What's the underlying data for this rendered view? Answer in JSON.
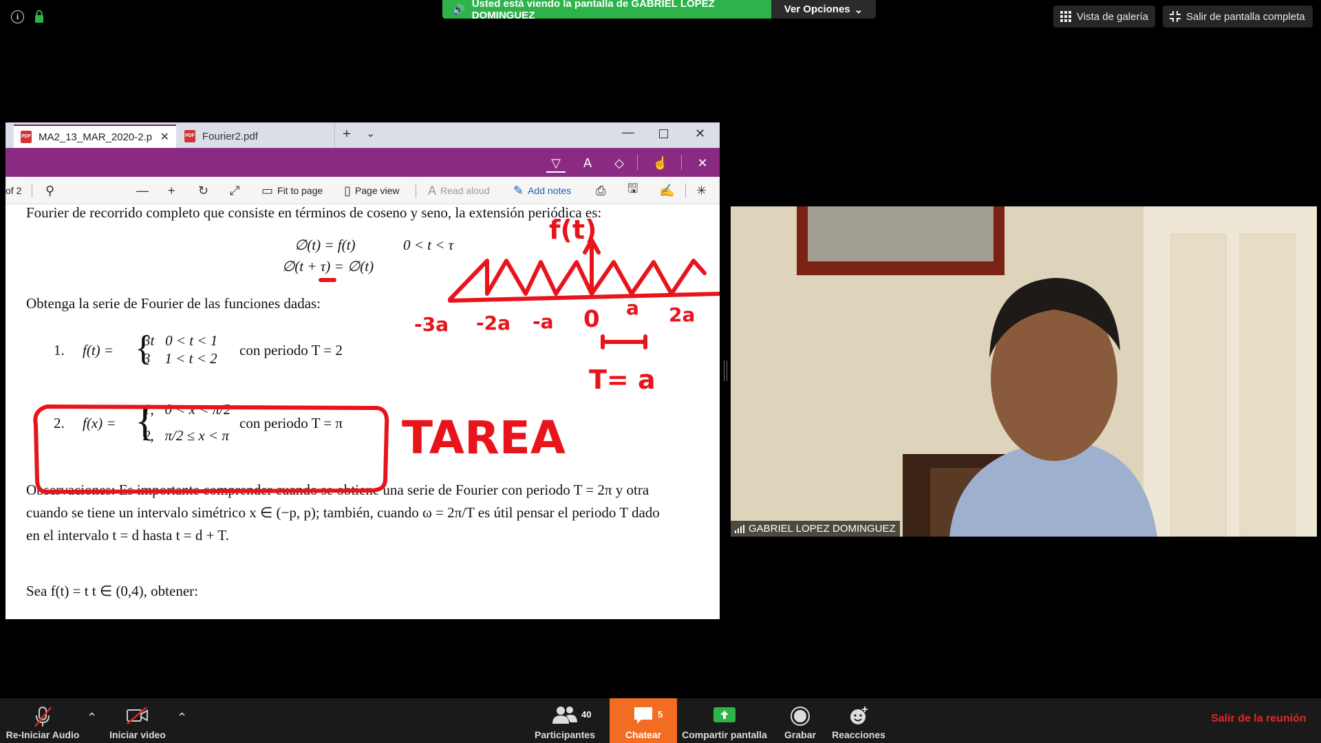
{
  "topbar": {
    "info_icon": "info-icon",
    "lock_icon": "lock-icon",
    "share_banner": "Usted está viendo la pantalla de GABRIEL LOPEZ DOMINGUEZ",
    "view_options": "Ver Opciones",
    "gallery_view": "Vista de galería",
    "exit_fullscreen": "Salir de pantalla completa"
  },
  "pdf_window": {
    "tabs": [
      {
        "label": "MA2_13_MAR_2020-2.p",
        "active": true
      },
      {
        "label": "Fourier2.pdf",
        "active": false
      }
    ],
    "window_controls": [
      "minimize-icon",
      "maximize-icon",
      "close-icon"
    ],
    "ink_tools": [
      "pen-icon",
      "highlighter-icon",
      "eraser-icon",
      "touch-writing-icon",
      "close-icon"
    ],
    "toolbar": {
      "page_indicator": "of 2",
      "fit_to_page": "Fit to page",
      "page_view": "Page view",
      "read_aloud": "Read aloud",
      "add_notes": "Add notes"
    },
    "document": {
      "line1": "Fourier de recorrido completo que consiste en términos de coseno y seno, la extensión periódica es:",
      "eq1": "∅(t) = f(t)",
      "eq1_cond": "0 < t < τ",
      "eq2": "∅(t + τ) = ∅(t)",
      "instruction": "Obtenga la serie de Fourier de las funciones dadas:",
      "item1_num": "1.",
      "item1_lhs": "f(t) =",
      "item1_case1": "3t   0 < t < 1",
      "item1_case2": "3    1 < t < 2",
      "item1_period": "con periodo T = 2",
      "item2_num": "2.",
      "item2_lhs": "f(x) =",
      "item2_case1": "1,   0 < x < π/2",
      "item2_case2": "2,   π/2 ≤ x < π",
      "item2_period": "con periodo T = π",
      "obs1": "Observaciones: Es importante comprender cuando se obtiene una serie de Fourier con periodo T = 2π y otra",
      "obs2": "cuando se tiene un intervalo simétrico x ∈ (−p, p); también, cuando ω = 2π/T es útil pensar el periodo T dado",
      "obs3": "en el intervalo t = d hasta t = d + T.",
      "exercise": "Sea f(t) = t   t ∈ (0,4), obtener:"
    },
    "annotations": {
      "ft": "f(t)",
      "axis_labels": [
        "-3a",
        "-2a",
        "-a",
        "0",
        "a",
        "2a"
      ],
      "period": "T= a",
      "homework": "TAREA",
      "ink_color": "#e8141c"
    }
  },
  "video": {
    "participant_name": "GABRIEL LOPEZ DOMINGUEZ",
    "signal_icon": "signal-icon"
  },
  "bottombar": {
    "audio": "Re-Iniciar Audio",
    "video": "Iniciar video",
    "participants": "Participantes",
    "participants_count": "40",
    "chat": "Chatear",
    "chat_count": "5",
    "share": "Compartir pantalla",
    "record": "Grabar",
    "reactions": "Reacciones",
    "leave": "Salir de la reunión"
  },
  "colors": {
    "banner_green": "#2db34a",
    "ink_toolbar": "#8b2a82",
    "chat_orange": "#f26d21",
    "leave_red": "#e02828"
  }
}
